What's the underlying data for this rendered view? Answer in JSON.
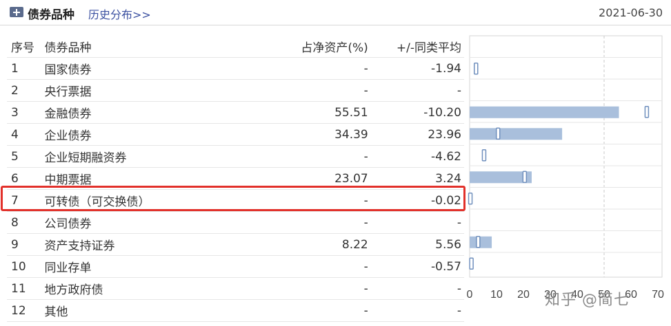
{
  "header": {
    "icon": "plus-square-icon",
    "title": "债券品种",
    "history_link": "历史分布>>",
    "date": "2021-06-30"
  },
  "table": {
    "columns": [
      "序号",
      "债券品种",
      "占净资产(%)",
      "+/-同类平均"
    ],
    "rows": [
      {
        "no": "1",
        "name": "国家债券",
        "pct": "-",
        "avg": "-1.94"
      },
      {
        "no": "2",
        "name": "央行票据",
        "pct": "-",
        "avg": "-"
      },
      {
        "no": "3",
        "name": "金融债券",
        "pct": "55.51",
        "avg": "-10.20"
      },
      {
        "no": "4",
        "name": "企业债券",
        "pct": "34.39",
        "avg": "23.96"
      },
      {
        "no": "5",
        "name": "企业短期融资券",
        "pct": "-",
        "avg": "-4.62"
      },
      {
        "no": "6",
        "name": "中期票据",
        "pct": "23.07",
        "avg": "3.24"
      },
      {
        "no": "7",
        "name": "可转债（可交换债）",
        "pct": "-",
        "avg": "-0.02"
      },
      {
        "no": "8",
        "name": "公司债券",
        "pct": "-",
        "avg": "-"
      },
      {
        "no": "9",
        "name": "资产支持证券",
        "pct": "8.22",
        "avg": "5.56"
      },
      {
        "no": "10",
        "name": "同业存单",
        "pct": "-",
        "avg": "-0.57"
      },
      {
        "no": "11",
        "name": "地方政府债",
        "pct": "-",
        "avg": "-"
      },
      {
        "no": "12",
        "name": "其他",
        "pct": "-",
        "avg": "-"
      }
    ],
    "highlighted_row": 7,
    "highlight_color": "#e2302a"
  },
  "chart_data": {
    "type": "bar",
    "orientation": "horizontal",
    "categories": [
      "国家债券",
      "央行票据",
      "金融债券",
      "企业债券",
      "企业短期融资券",
      "中期票据",
      "可转债（可交换债）",
      "公司债券",
      "资产支持证券",
      "同业存单",
      "地方政府债",
      "其他"
    ],
    "series": [
      {
        "values": [
          null,
          null,
          55.51,
          34.39,
          null,
          23.07,
          null,
          null,
          8.22,
          null,
          null,
          null
        ],
        "color": "#a9bfdc"
      },
      {
        "values": [
          2.5,
          null,
          66,
          10.7,
          5.5,
          20.6,
          0.4,
          null,
          3.3,
          0.8,
          null,
          null
        ],
        "color": "#ffffff",
        "border": "#6f8fbd"
      }
    ],
    "xlim": [
      0,
      70
    ],
    "xticks": [
      "0",
      "10",
      "20",
      "30",
      "40",
      "50",
      "60",
      "70"
    ],
    "grid": "dashed vertical at 50"
  },
  "watermark": "知乎 @简七"
}
